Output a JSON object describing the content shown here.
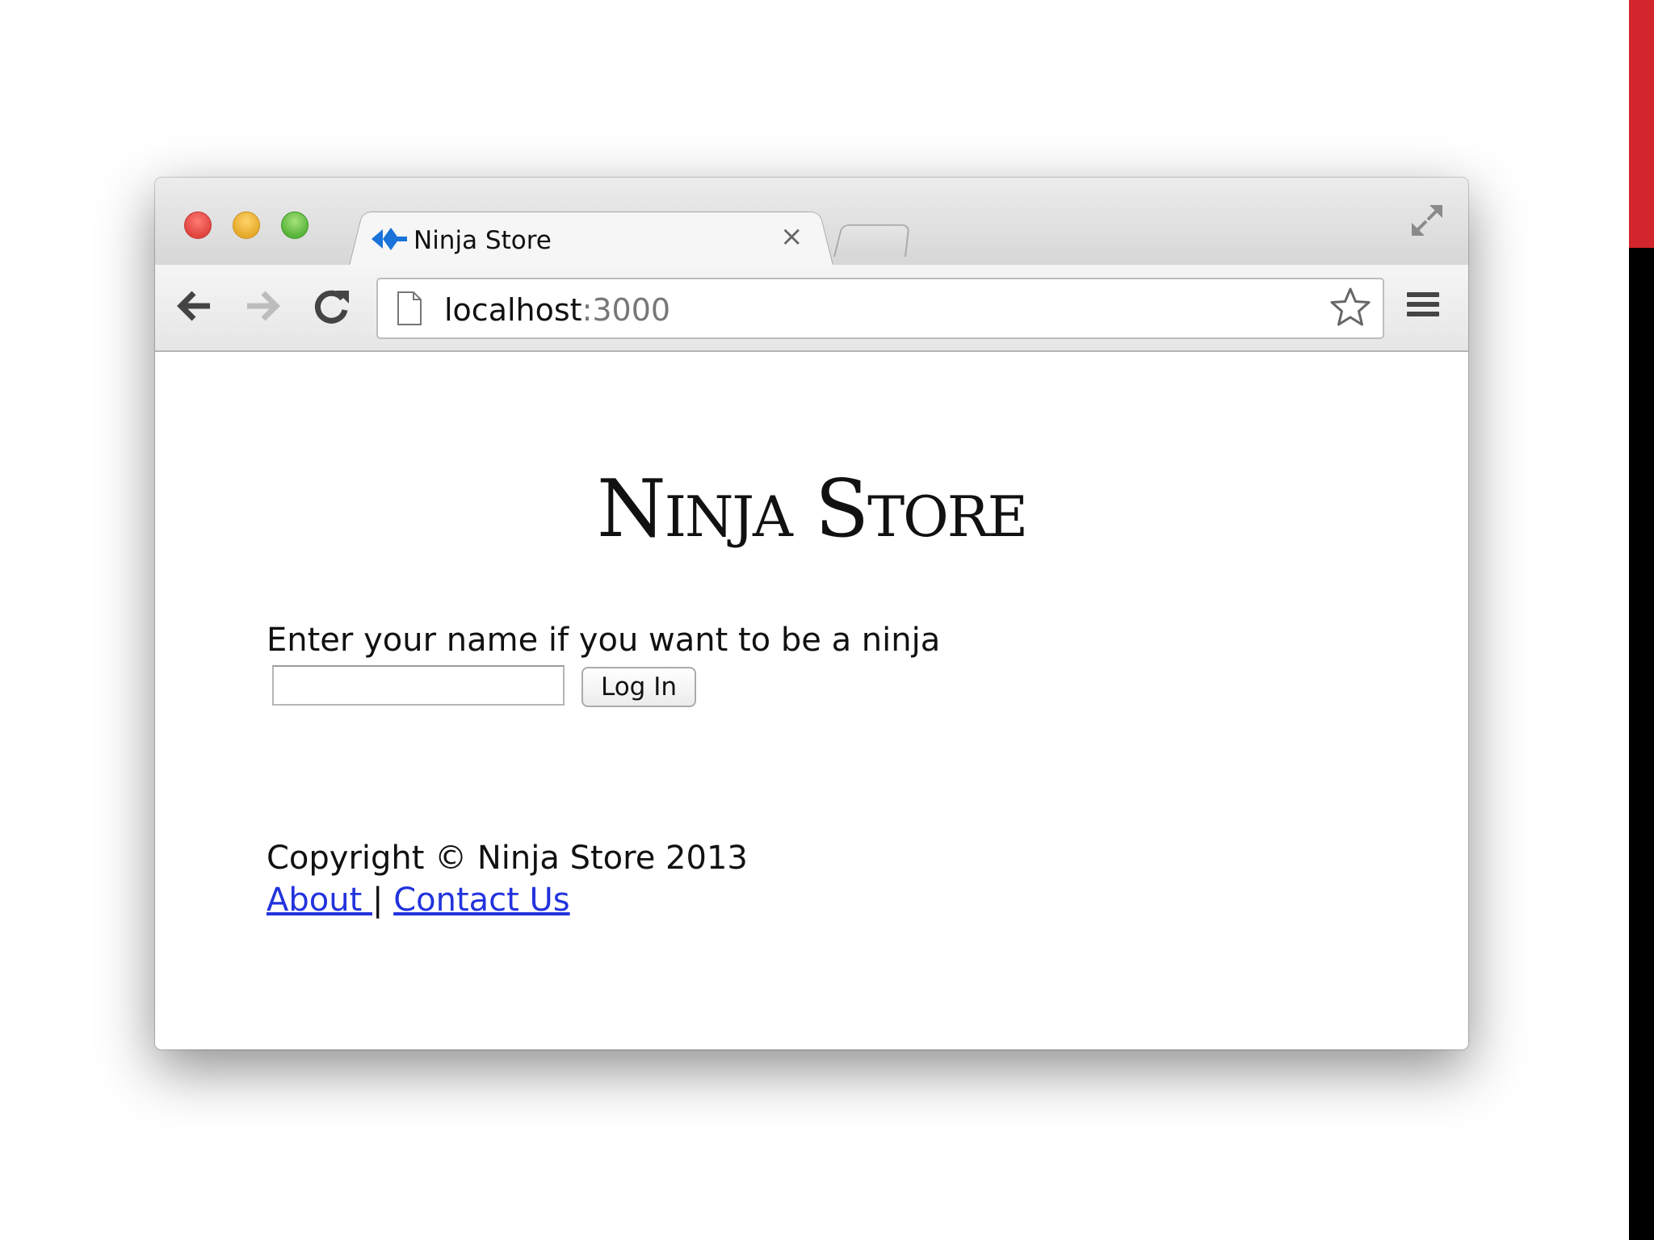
{
  "browser": {
    "tab": {
      "title": "Ninja Store",
      "close_glyph": "×",
      "favicon": "ninja-star-icon"
    },
    "address_bar": {
      "host": "localhost",
      "port": ":3000"
    },
    "icons": {
      "back": "back-arrow-icon",
      "forward": "forward-arrow-icon",
      "reload": "reload-icon",
      "page": "page-icon",
      "bookmark": "star-icon",
      "menu": "hamburger-menu-icon",
      "fullscreen": "fullscreen-icon"
    }
  },
  "page": {
    "title": "Ninja Store",
    "login_form": {
      "prompt": "Enter your name if you want to be a ninja",
      "name_value": "",
      "submit_label": "Log In"
    },
    "footer": {
      "copyright": "Copyright © Ninja Store 2013",
      "links": [
        {
          "label": "About "
        },
        {
          "label": "Contact Us"
        }
      ],
      "separator": "|"
    }
  },
  "colors": {
    "side_red": "#d3262c",
    "side_black": "#000000",
    "link": "#2233dd",
    "favicon_blue": "#1a73d9"
  }
}
